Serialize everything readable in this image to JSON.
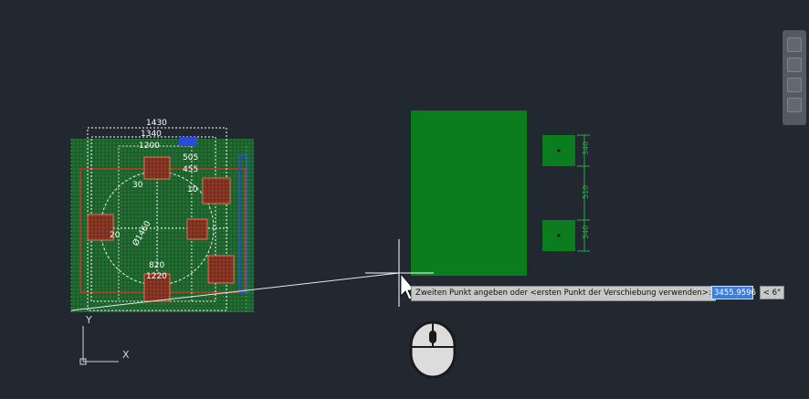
{
  "drawing": {
    "dimensions_top": [
      "1430",
      "1340",
      "1200",
      "505",
      "455"
    ],
    "dimensions_inner": [
      "30",
      "10",
      "20",
      "820",
      "1220"
    ],
    "dimensions_diag": "Ø1460",
    "dimensions_right_panel": [
      "340",
      "510",
      "340"
    ]
  },
  "ucs": {
    "y_label": "Y",
    "x_label": "X"
  },
  "command": {
    "prompt": "Zweiten Punkt angeben oder <ersten Punkt der Verschiebung verwenden>:",
    "value": "3455.9596",
    "angle": "< 6°"
  },
  "icons": {
    "nav_bar": "navigation-bar-icon",
    "mouse": "mouse-icon",
    "cursor": "arrow-cursor-icon",
    "crosshair": "crosshair-icon"
  },
  "colors": {
    "background": "#212830",
    "green_fill": "#0b7d1f",
    "red": "#c0392b",
    "blue": "#2a4bd6"
  }
}
